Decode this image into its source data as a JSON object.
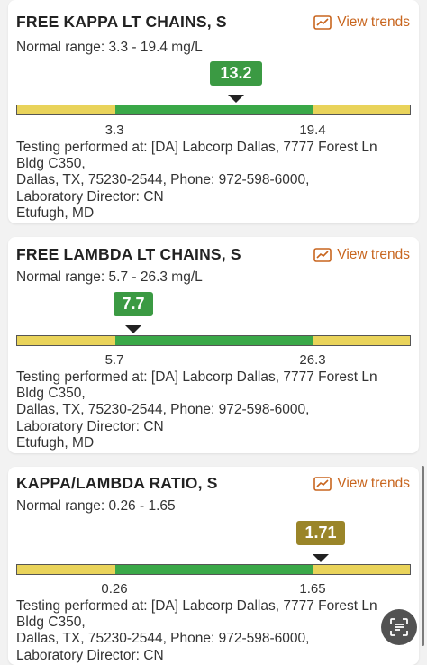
{
  "colors": {
    "orange_accent": "#c8651e",
    "normal_band": "#3aa848",
    "out_of_range_band": "#e9d35a",
    "badge_in_range": "#3b9a43",
    "badge_out_of_range": "#9a8529"
  },
  "results": [
    {
      "title": "FREE KAPPA LT CHAINS, S",
      "trends_label": "View trends",
      "trends_icon": "trend-chart-icon",
      "normal_range": "Normal range: 3.3 - 19.4 mg/L",
      "value_label": "13.2",
      "low_label": "3.3",
      "high_label": "19.4",
      "status": "in-range",
      "lab_info": "Testing performed at: [DA] Labcorp Dallas, 7777 Forest Ln\nBldg C350,\nDallas, TX, 75230-2544, Phone: 972-598-6000,\nLaboratory Director: CN\nEtufugh, MD"
    },
    {
      "title": "FREE LAMBDA LT CHAINS, S",
      "trends_label": "View trends",
      "trends_icon": "trend-chart-icon",
      "normal_range": "Normal range: 5.7 - 26.3 mg/L",
      "value_label": "7.7",
      "low_label": "5.7",
      "high_label": "26.3",
      "status": "in-range",
      "lab_info": "Testing performed at: [DA] Labcorp Dallas, 7777 Forest Ln\nBldg C350,\nDallas, TX, 75230-2544, Phone: 972-598-6000,\nLaboratory Director: CN\nEtufugh, MD"
    },
    {
      "title": "KAPPA/LAMBDA RATIO, S",
      "trends_label": "View trends",
      "trends_icon": "trend-chart-icon",
      "normal_range": "Normal range: 0.26 - 1.65",
      "value_label": "1.71",
      "low_label": "0.26",
      "high_label": "1.65",
      "status": "out-of-range",
      "lab_info": "Testing performed at: [DA] Labcorp Dallas, 7777 Forest Ln\nBldg C350,\nDallas, TX, 75230-2544, Phone: 972-598-6000,\nLaboratory Director: CN"
    }
  ],
  "fab_icon": "document-scan-icon"
}
